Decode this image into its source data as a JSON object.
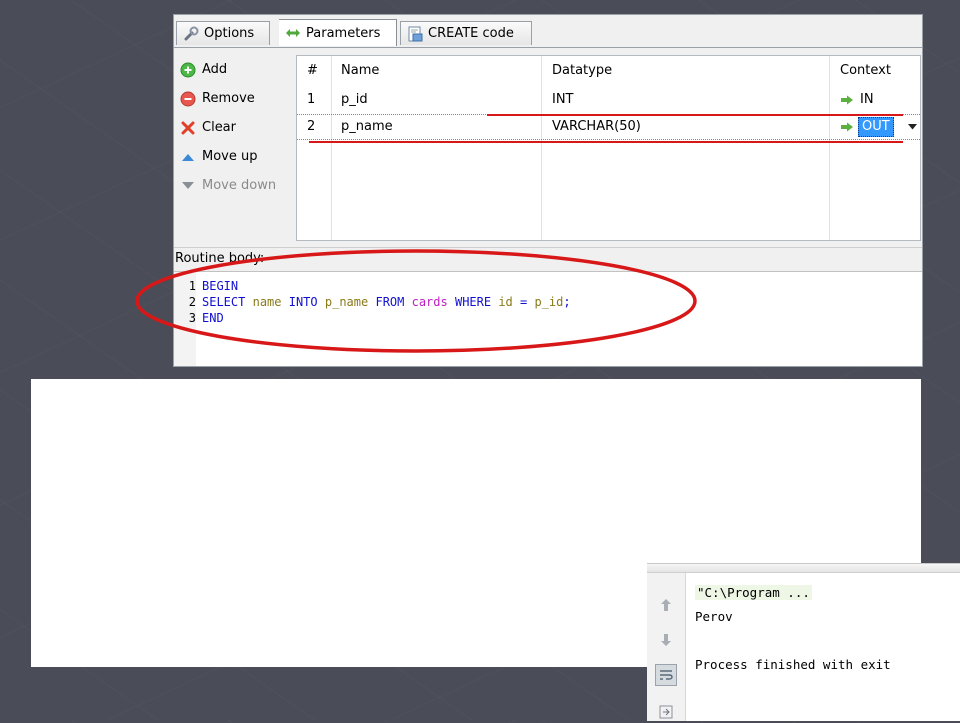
{
  "tabs": [
    {
      "label": "Options",
      "icon": "wrench-icon"
    },
    {
      "label": "Parameters",
      "icon": "double-arrow-icon"
    },
    {
      "label": "CREATE code",
      "icon": "code-document-icon"
    }
  ],
  "actions": [
    {
      "label": "Add",
      "icon": "add-circle-icon",
      "enabled": true
    },
    {
      "label": "Remove",
      "icon": "remove-circle-icon",
      "enabled": true
    },
    {
      "label": "Clear",
      "icon": "clear-x-icon",
      "enabled": true
    },
    {
      "label": "Move up",
      "icon": "triangle-up-icon",
      "enabled": true
    },
    {
      "label": "Move down",
      "icon": "triangle-down-icon",
      "enabled": false
    }
  ],
  "grid": {
    "headers": [
      "#",
      "Name",
      "Datatype",
      "Context"
    ],
    "rows": [
      {
        "num": "1",
        "name": "p_id",
        "datatype": "INT",
        "context": "IN"
      },
      {
        "num": "2",
        "name": "p_name",
        "datatype": "VARCHAR(50)",
        "context": "OUT"
      }
    ],
    "selected_row": 2
  },
  "routine_body_label": "Routine body:",
  "code_lines": [
    {
      "num": "1",
      "tokens": [
        {
          "t": "BEGIN",
          "c": "kw"
        }
      ]
    },
    {
      "num": "2",
      "tokens": [
        {
          "t": "SELECT",
          "c": "kw"
        },
        {
          "t": " ",
          "c": ""
        },
        {
          "t": "name",
          "c": "id"
        },
        {
          "t": " ",
          "c": ""
        },
        {
          "t": "INTO",
          "c": "kw"
        },
        {
          "t": " ",
          "c": ""
        },
        {
          "t": "p_name",
          "c": "id"
        },
        {
          "t": " ",
          "c": ""
        },
        {
          "t": "FROM",
          "c": "kw"
        },
        {
          "t": " ",
          "c": ""
        },
        {
          "t": "cards",
          "c": "tb"
        },
        {
          "t": " ",
          "c": ""
        },
        {
          "t": "WHERE",
          "c": "kw"
        },
        {
          "t": " ",
          "c": ""
        },
        {
          "t": "id",
          "c": "id"
        },
        {
          "t": " ",
          "c": ""
        },
        {
          "t": "=",
          "c": "op"
        },
        {
          "t": " ",
          "c": ""
        },
        {
          "t": "p_id",
          "c": "id"
        },
        {
          "t": ";",
          "c": "op"
        }
      ]
    },
    {
      "num": "3",
      "tokens": [
        {
          "t": "END",
          "c": "kw"
        }
      ]
    }
  ],
  "console": {
    "lines": [
      "\"C:\\Program ...",
      "Perov",
      "",
      "Process finished with exit"
    ],
    "buttons": [
      "up-arrow-icon",
      "down-arrow-icon",
      "soft-wrap-icon",
      "scroll-to-end-icon"
    ]
  },
  "colors": {
    "annotation_red": "#d81818",
    "selection_blue": "#3399ff",
    "keyword": "#1010d0",
    "identifier": "#8a7a1a",
    "table_name": "#c020c0"
  }
}
